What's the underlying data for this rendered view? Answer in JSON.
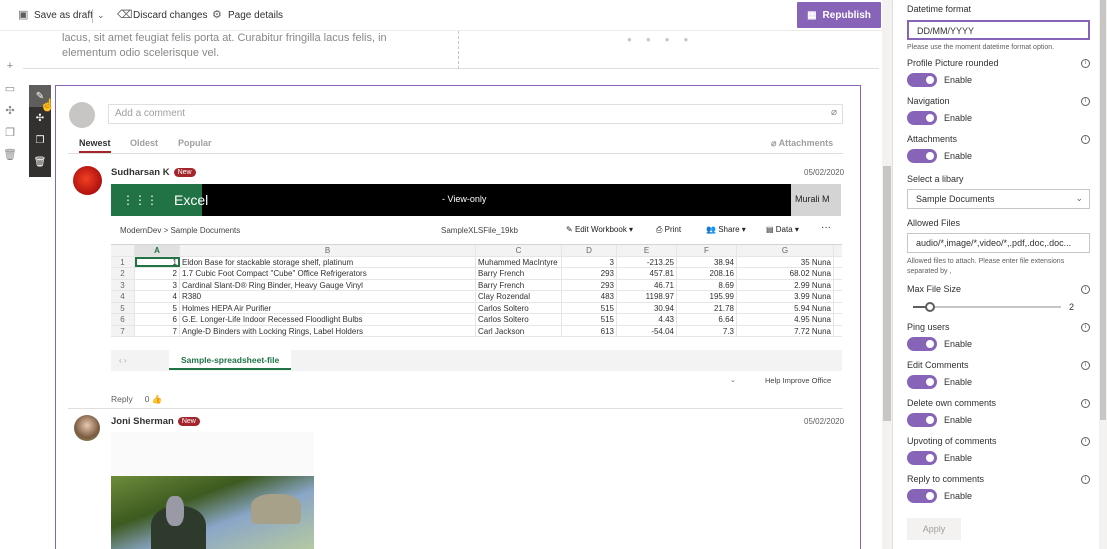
{
  "toolbar": {
    "save_draft": "Save as draft",
    "discard": "Discard changes",
    "page_details": "Page details",
    "republish": "Republish"
  },
  "section": {
    "text": "lacus, sit amet feugiat felis porta at. Curabitur fringilla lacus felis, in elementum odio scelerisque vel."
  },
  "comments": {
    "add_placeholder": "Add a comment",
    "tabs": [
      "Newest",
      "Oldest",
      "Popular"
    ],
    "attachments_label": "Attachments",
    "items": [
      {
        "name": "Sudharsan K",
        "badge": "New",
        "date": "05/02/2020",
        "reply": "Reply",
        "likes": "0"
      },
      {
        "name": "Joni Sherman",
        "badge": "New",
        "date": "05/02/2020"
      }
    ]
  },
  "excel": {
    "brand": "Excel",
    "mode": "View-only",
    "user": "Murali M",
    "breadcrumb": "ModernDev > Sample Documents",
    "file": "SampleXLSFile_19kb",
    "menu": [
      "Edit Workbook",
      "Print",
      "Share",
      "Data"
    ],
    "cols": [
      "",
      "A",
      "B",
      "C",
      "D",
      "E",
      "F",
      "G"
    ],
    "rows": [
      [
        "1",
        "1",
        "Eldon Base for stackable storage shelf, platinum",
        "Muhammed MacIntyre",
        "3",
        "-213.25",
        "38.94",
        "35 Nuna"
      ],
      [
        "2",
        "2",
        "1.7 Cubic Foot Compact \"Cube\" Office Refrigerators",
        "Barry French",
        "293",
        "457.81",
        "208.16",
        "68.02 Nuna"
      ],
      [
        "3",
        "3",
        "Cardinal Slant-D® Ring Binder, Heavy Gauge Vinyl",
        "Barry French",
        "293",
        "46.71",
        "8.69",
        "2.99 Nuna"
      ],
      [
        "4",
        "4",
        "R380",
        "Clay Rozendal",
        "483",
        "1198.97",
        "195.99",
        "3.99 Nuna"
      ],
      [
        "5",
        "5",
        "Holmes HEPA Air Purifier",
        "Carlos Soltero",
        "515",
        "30.94",
        "21.78",
        "5.94 Nuna"
      ],
      [
        "6",
        "6",
        "G.E. Longer-Life Indoor Recessed Floodlight Bulbs",
        "Carlos Soltero",
        "515",
        "4.43",
        "6.64",
        "4.95 Nuna"
      ],
      [
        "7",
        "7",
        "Angle-D Binders with Locking Rings, Label Holders",
        "Carl Jackson",
        "613",
        "-54.04",
        "7.3",
        "7.72 Nuna"
      ]
    ],
    "sheet_tab": "Sample-spreadsheet-file",
    "help": "Help Improve Office"
  },
  "panel": {
    "datetime_label": "Datetime format",
    "datetime_value": "DD/MM/YYYY",
    "datetime_help": "Please use the moment datetime format option.",
    "toggles": [
      {
        "label": "Profile Picture rounded",
        "state": "Enable"
      },
      {
        "label": "Navigation",
        "state": "Enable"
      },
      {
        "label": "Attachments",
        "state": "Enable"
      }
    ],
    "library_label": "Select a libary",
    "library_value": "Sample Documents",
    "allowed_label": "Allowed Files",
    "allowed_value": "audio/*,image/*,video/*,.pdf,.doc,.doc...",
    "allowed_help": "Allowed files to attach. Please enter file extensions separated by ,",
    "maxsize_label": "Max File Size",
    "maxsize_value": "2",
    "toggles2": [
      {
        "label": "Ping users",
        "state": "Enable"
      },
      {
        "label": "Edit Comments",
        "state": "Enable"
      },
      {
        "label": "Delete own comments",
        "state": "Enable"
      },
      {
        "label": "Upvoting of comments",
        "state": "Enable"
      },
      {
        "label": "Reply to comments",
        "state": "Enable"
      }
    ],
    "apply": "Apply"
  }
}
